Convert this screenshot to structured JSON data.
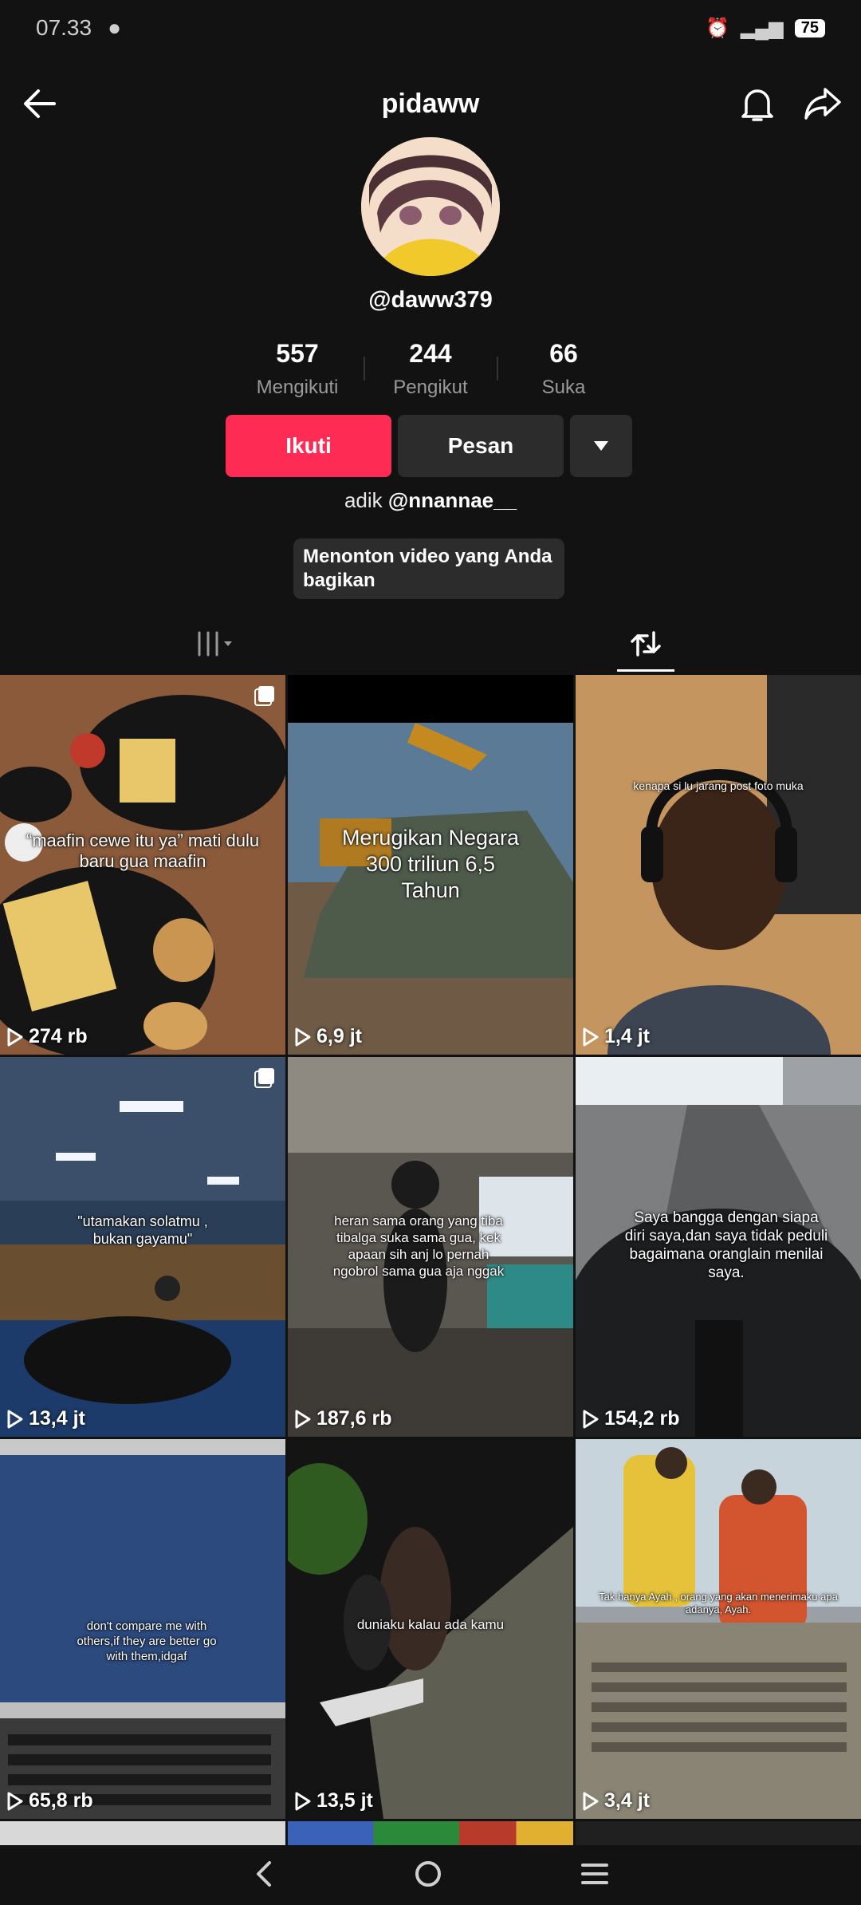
{
  "status": {
    "time": "07.33",
    "battery": "75"
  },
  "header": {
    "title": "pidaww"
  },
  "profile": {
    "handle": "@daww379",
    "stats": [
      {
        "value": "557",
        "label": "Mengikuti"
      },
      {
        "value": "244",
        "label": "Pengikut"
      },
      {
        "value": "66",
        "label": "Suka"
      }
    ],
    "follow_label": "Ikuti",
    "message_label": "Pesan",
    "bio_text": "adik ",
    "bio_mention": "@nnannae__",
    "chip_text": "Menonton video yang Anda bagikan"
  },
  "videos": [
    {
      "views": "274 rb",
      "caption": "“maafin cewe itu ya” mati dulu baru gua maafin"
    },
    {
      "views": "6,9 jt",
      "caption": "Merugikan Negara 300 triliun 6,5 Tahun"
    },
    {
      "views": "1,4 jt",
      "caption": "kenapa si lu jarang post foto muka"
    },
    {
      "views": "13,4 jt",
      "caption": "\"utamakan solatmu , bukan gayamu\""
    },
    {
      "views": "187,6 rb",
      "caption": "heran sama orang yang tiba tibalga suka sama gua, kek apaan sih anj lo pernah ngobrol sama gua aja nggak"
    },
    {
      "views": "154,2 rb",
      "caption": "Saya bangga dengan siapa diri saya,dan saya tidak peduli bagaimana oranglain menilai saya."
    },
    {
      "views": "65,8 rb",
      "caption": "don't compare me with others,if they are better go with them,idgaf"
    },
    {
      "views": "13,5 jt",
      "caption": "duniaku kalau ada kamu"
    },
    {
      "views": "3,4 jt",
      "caption": "Tak hanya Ayah , orang yang akan menerimaku apa adanya, Ayah."
    }
  ],
  "colors": {
    "accent": "#fe2c55",
    "background": "#121212",
    "button": "#2c2c2c"
  }
}
